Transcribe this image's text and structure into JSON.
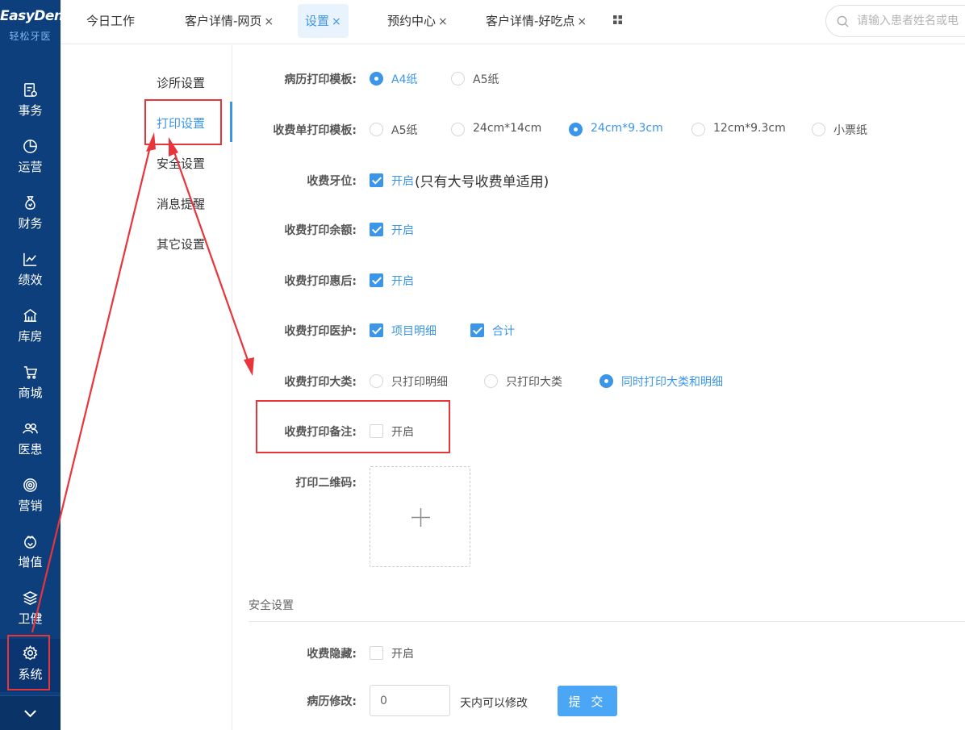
{
  "brand": {
    "name": "EasyDent",
    "sub": "轻松牙医"
  },
  "nav": {
    "items": [
      {
        "label": "事务",
        "icon": "document-icon"
      },
      {
        "label": "运营",
        "icon": "pie-chart-icon"
      },
      {
        "label": "财务",
        "icon": "money-bag-icon"
      },
      {
        "label": "绩效",
        "icon": "line-chart-icon"
      },
      {
        "label": "库房",
        "icon": "warehouse-icon"
      },
      {
        "label": "商城",
        "icon": "cart-icon"
      },
      {
        "label": "医患",
        "icon": "people-icon"
      },
      {
        "label": "营销",
        "icon": "target-icon"
      },
      {
        "label": "增值",
        "icon": "gift-icon"
      },
      {
        "label": "卫健",
        "icon": "layers-icon"
      },
      {
        "label": "系统",
        "icon": "gear-icon"
      }
    ],
    "expand_icon": "chevron-down-icon"
  },
  "tabs": [
    {
      "label": "今日工作",
      "closable": false
    },
    {
      "label": "客户详情-网页",
      "closable": true
    },
    {
      "label": "设置",
      "closable": true,
      "active": true
    },
    {
      "label": "预约中心",
      "closable": true
    },
    {
      "label": "客户详情-好吃点",
      "closable": true
    }
  ],
  "close_glyph": "×",
  "search": {
    "placeholder": "请输入患者姓名或电"
  },
  "submenu": {
    "items": [
      "诊所设置",
      "打印设置",
      "安全设置",
      "消息提醒",
      "其它设置"
    ],
    "active_index": 1
  },
  "form": {
    "medical_record_template": {
      "label": "病历打印模板:",
      "options": [
        "A4纸",
        "A5纸"
      ],
      "selected": "A4纸"
    },
    "receipt_template": {
      "label": "收费单打印模板:",
      "options": [
        "A5纸",
        "24cm*14cm",
        "24cm*9.3cm",
        "12cm*9.3cm",
        "小票纸"
      ],
      "selected": "24cm*9.3cm"
    },
    "tooth_position": {
      "label": "收费牙位:",
      "option": "开启",
      "checked": true,
      "note": "(只有大号收费单适用)"
    },
    "print_balance": {
      "label": "收费打印余额:",
      "option": "开启",
      "checked": true
    },
    "print_discount": {
      "label": "收费打印惠后:",
      "option": "开启",
      "checked": true
    },
    "print_insurance": {
      "label": "收费打印医护:",
      "options": [
        {
          "label": "项目明细",
          "checked": true
        },
        {
          "label": "合计",
          "checked": true
        }
      ]
    },
    "print_category": {
      "label": "收费打印大类:",
      "options": [
        "只打印明细",
        "只打印大类",
        "同时打印大类和明细"
      ],
      "selected": "同时打印大类和明细"
    },
    "print_remark": {
      "label": "收费打印备注:",
      "option": "开启",
      "checked": false
    },
    "qr_code": {
      "label": "打印二维码:",
      "upload_icon": "plus-icon"
    },
    "security_section": "安全设置",
    "fee_hidden": {
      "label": "收费隐藏:",
      "option": "开启",
      "checked": false
    },
    "record_edit": {
      "label": "病历修改:",
      "value": "0",
      "suffix": "天内可以修改",
      "submit_label": "提 交"
    }
  },
  "colors": {
    "nav_bg": "#0e3f7d",
    "accent": "#3b95e8",
    "annotation": "#e8343b",
    "submit_bg": "#4ba6f5"
  }
}
